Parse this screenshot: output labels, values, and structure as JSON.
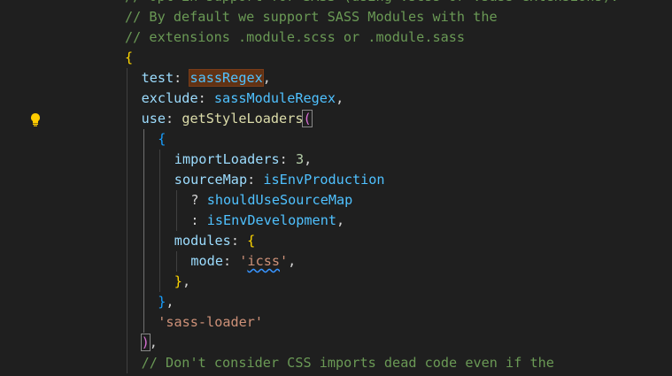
{
  "editor": {
    "lines": [
      {
        "indent": 0,
        "tokens": [
          {
            "t": "// Opt-in support for SASS (using .scss or .sass extensions).",
            "c": "c-comment"
          }
        ]
      },
      {
        "indent": 0,
        "tokens": [
          {
            "t": "// By default we support SASS Modules with the",
            "c": "c-comment"
          }
        ]
      },
      {
        "indent": 0,
        "tokens": [
          {
            "t": "// extensions .module.scss or .module.sass",
            "c": "c-comment"
          }
        ]
      },
      {
        "indent": 0,
        "tokens": [
          {
            "t": "{",
            "c": "c-brace-y"
          }
        ]
      },
      {
        "indent": 1,
        "tokens": [
          {
            "t": "test",
            "c": "c-prop"
          },
          {
            "t": ": ",
            "c": "c-punc"
          },
          {
            "t": "sassRegex",
            "c": "c-var",
            "hl": true
          },
          {
            "t": ",",
            "c": "c-punc"
          }
        ]
      },
      {
        "indent": 1,
        "tokens": [
          {
            "t": "exclude",
            "c": "c-prop"
          },
          {
            "t": ": ",
            "c": "c-punc"
          },
          {
            "t": "sassModuleRegex",
            "c": "c-var"
          },
          {
            "t": ",",
            "c": "c-punc"
          }
        ]
      },
      {
        "indent": 1,
        "bulb": true,
        "tokens": [
          {
            "t": "use",
            "c": "c-prop"
          },
          {
            "t": ": ",
            "c": "c-punc"
          },
          {
            "t": "getStyleLoaders",
            "c": "c-func"
          },
          {
            "t": "(",
            "c": "c-brace-p",
            "match": true
          }
        ]
      },
      {
        "indent": 2,
        "tokens": [
          {
            "t": "{",
            "c": "c-brace-b"
          }
        ]
      },
      {
        "indent": 3,
        "tokens": [
          {
            "t": "importLoaders",
            "c": "c-prop"
          },
          {
            "t": ": ",
            "c": "c-punc"
          },
          {
            "t": "3",
            "c": "c-num"
          },
          {
            "t": ",",
            "c": "c-punc"
          }
        ]
      },
      {
        "indent": 3,
        "tokens": [
          {
            "t": "sourceMap",
            "c": "c-prop"
          },
          {
            "t": ": ",
            "c": "c-punc"
          },
          {
            "t": "isEnvProduction",
            "c": "c-var"
          }
        ]
      },
      {
        "indent": 4,
        "tokens": [
          {
            "t": "? ",
            "c": "c-punc"
          },
          {
            "t": "shouldUseSourceMap",
            "c": "c-var"
          }
        ]
      },
      {
        "indent": 4,
        "tokens": [
          {
            "t": ": ",
            "c": "c-punc"
          },
          {
            "t": "isEnvDevelopment",
            "c": "c-var"
          },
          {
            "t": ",",
            "c": "c-punc"
          }
        ]
      },
      {
        "indent": 3,
        "tokens": [
          {
            "t": "modules",
            "c": "c-prop"
          },
          {
            "t": ": ",
            "c": "c-punc"
          },
          {
            "t": "{",
            "c": "c-brace-y"
          }
        ]
      },
      {
        "indent": 4,
        "tokens": [
          {
            "t": "mode",
            "c": "c-prop"
          },
          {
            "t": ": ",
            "c": "c-punc"
          },
          {
            "t": "'",
            "c": "c-str"
          },
          {
            "t": "icss",
            "c": "c-str",
            "squiggle": true
          },
          {
            "t": "'",
            "c": "c-str"
          },
          {
            "t": ",",
            "c": "c-punc"
          }
        ]
      },
      {
        "indent": 3,
        "tokens": [
          {
            "t": "}",
            "c": "c-brace-y"
          },
          {
            "t": ",",
            "c": "c-punc"
          }
        ]
      },
      {
        "indent": 2,
        "tokens": [
          {
            "t": "}",
            "c": "c-brace-b"
          },
          {
            "t": ",",
            "c": "c-punc"
          }
        ]
      },
      {
        "indent": 2,
        "tokens": [
          {
            "t": "'sass-loader'",
            "c": "c-str"
          }
        ]
      },
      {
        "indent": 1,
        "tokens": [
          {
            "t": ")",
            "c": "c-brace-p",
            "match": true
          },
          {
            "t": ",",
            "c": "c-punc"
          }
        ]
      },
      {
        "indent": 1,
        "tokens": [
          {
            "t": "// Don't consider CSS imports dead code even if the",
            "c": "c-comment"
          }
        ]
      }
    ]
  },
  "colors": {
    "background": "#1f1f1f",
    "comment": "#6a9955",
    "property": "#9cdcfe",
    "variable": "#4fc1ff",
    "function": "#dcdcaa",
    "string": "#ce9178",
    "number": "#b5cea8",
    "lightbulb": "#ffcc00"
  },
  "icons": {
    "code_action": "lightbulb-icon"
  }
}
